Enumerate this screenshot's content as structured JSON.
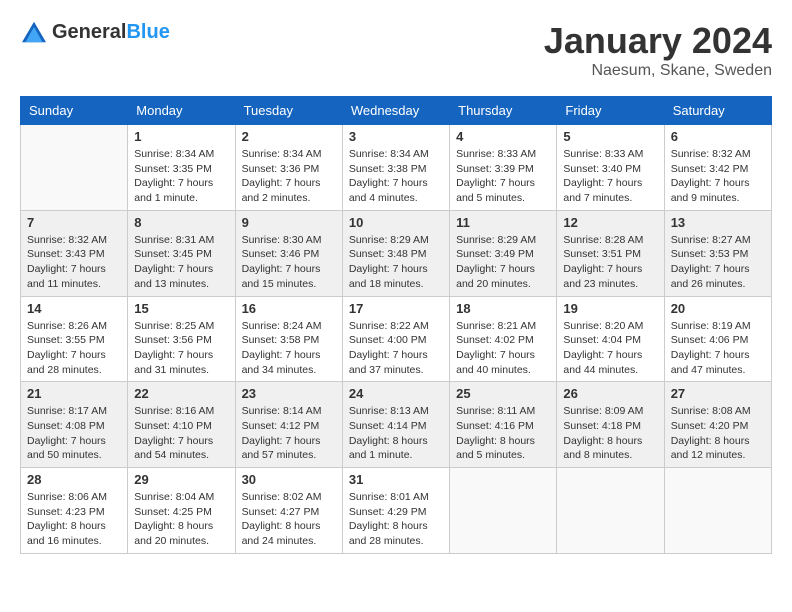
{
  "header": {
    "logo": {
      "text_general": "General",
      "text_blue": "Blue"
    },
    "title": "January 2024",
    "location": "Naesum, Skane, Sweden"
  },
  "weekdays": [
    "Sunday",
    "Monday",
    "Tuesday",
    "Wednesday",
    "Thursday",
    "Friday",
    "Saturday"
  ],
  "weeks": [
    [
      {
        "day": null,
        "sunrise": null,
        "sunset": null,
        "daylight": null
      },
      {
        "day": "1",
        "sunrise": "Sunrise: 8:34 AM",
        "sunset": "Sunset: 3:35 PM",
        "daylight": "Daylight: 7 hours and 1 minute."
      },
      {
        "day": "2",
        "sunrise": "Sunrise: 8:34 AM",
        "sunset": "Sunset: 3:36 PM",
        "daylight": "Daylight: 7 hours and 2 minutes."
      },
      {
        "day": "3",
        "sunrise": "Sunrise: 8:34 AM",
        "sunset": "Sunset: 3:38 PM",
        "daylight": "Daylight: 7 hours and 4 minutes."
      },
      {
        "day": "4",
        "sunrise": "Sunrise: 8:33 AM",
        "sunset": "Sunset: 3:39 PM",
        "daylight": "Daylight: 7 hours and 5 minutes."
      },
      {
        "day": "5",
        "sunrise": "Sunrise: 8:33 AM",
        "sunset": "Sunset: 3:40 PM",
        "daylight": "Daylight: 7 hours and 7 minutes."
      },
      {
        "day": "6",
        "sunrise": "Sunrise: 8:32 AM",
        "sunset": "Sunset: 3:42 PM",
        "daylight": "Daylight: 7 hours and 9 minutes."
      }
    ],
    [
      {
        "day": "7",
        "sunrise": "Sunrise: 8:32 AM",
        "sunset": "Sunset: 3:43 PM",
        "daylight": "Daylight: 7 hours and 11 minutes."
      },
      {
        "day": "8",
        "sunrise": "Sunrise: 8:31 AM",
        "sunset": "Sunset: 3:45 PM",
        "daylight": "Daylight: 7 hours and 13 minutes."
      },
      {
        "day": "9",
        "sunrise": "Sunrise: 8:30 AM",
        "sunset": "Sunset: 3:46 PM",
        "daylight": "Daylight: 7 hours and 15 minutes."
      },
      {
        "day": "10",
        "sunrise": "Sunrise: 8:29 AM",
        "sunset": "Sunset: 3:48 PM",
        "daylight": "Daylight: 7 hours and 18 minutes."
      },
      {
        "day": "11",
        "sunrise": "Sunrise: 8:29 AM",
        "sunset": "Sunset: 3:49 PM",
        "daylight": "Daylight: 7 hours and 20 minutes."
      },
      {
        "day": "12",
        "sunrise": "Sunrise: 8:28 AM",
        "sunset": "Sunset: 3:51 PM",
        "daylight": "Daylight: 7 hours and 23 minutes."
      },
      {
        "day": "13",
        "sunrise": "Sunrise: 8:27 AM",
        "sunset": "Sunset: 3:53 PM",
        "daylight": "Daylight: 7 hours and 26 minutes."
      }
    ],
    [
      {
        "day": "14",
        "sunrise": "Sunrise: 8:26 AM",
        "sunset": "Sunset: 3:55 PM",
        "daylight": "Daylight: 7 hours and 28 minutes."
      },
      {
        "day": "15",
        "sunrise": "Sunrise: 8:25 AM",
        "sunset": "Sunset: 3:56 PM",
        "daylight": "Daylight: 7 hours and 31 minutes."
      },
      {
        "day": "16",
        "sunrise": "Sunrise: 8:24 AM",
        "sunset": "Sunset: 3:58 PM",
        "daylight": "Daylight: 7 hours and 34 minutes."
      },
      {
        "day": "17",
        "sunrise": "Sunrise: 8:22 AM",
        "sunset": "Sunset: 4:00 PM",
        "daylight": "Daylight: 7 hours and 37 minutes."
      },
      {
        "day": "18",
        "sunrise": "Sunrise: 8:21 AM",
        "sunset": "Sunset: 4:02 PM",
        "daylight": "Daylight: 7 hours and 40 minutes."
      },
      {
        "day": "19",
        "sunrise": "Sunrise: 8:20 AM",
        "sunset": "Sunset: 4:04 PM",
        "daylight": "Daylight: 7 hours and 44 minutes."
      },
      {
        "day": "20",
        "sunrise": "Sunrise: 8:19 AM",
        "sunset": "Sunset: 4:06 PM",
        "daylight": "Daylight: 7 hours and 47 minutes."
      }
    ],
    [
      {
        "day": "21",
        "sunrise": "Sunrise: 8:17 AM",
        "sunset": "Sunset: 4:08 PM",
        "daylight": "Daylight: 7 hours and 50 minutes."
      },
      {
        "day": "22",
        "sunrise": "Sunrise: 8:16 AM",
        "sunset": "Sunset: 4:10 PM",
        "daylight": "Daylight: 7 hours and 54 minutes."
      },
      {
        "day": "23",
        "sunrise": "Sunrise: 8:14 AM",
        "sunset": "Sunset: 4:12 PM",
        "daylight": "Daylight: 7 hours and 57 minutes."
      },
      {
        "day": "24",
        "sunrise": "Sunrise: 8:13 AM",
        "sunset": "Sunset: 4:14 PM",
        "daylight": "Daylight: 8 hours and 1 minute."
      },
      {
        "day": "25",
        "sunrise": "Sunrise: 8:11 AM",
        "sunset": "Sunset: 4:16 PM",
        "daylight": "Daylight: 8 hours and 5 minutes."
      },
      {
        "day": "26",
        "sunrise": "Sunrise: 8:09 AM",
        "sunset": "Sunset: 4:18 PM",
        "daylight": "Daylight: 8 hours and 8 minutes."
      },
      {
        "day": "27",
        "sunrise": "Sunrise: 8:08 AM",
        "sunset": "Sunset: 4:20 PM",
        "daylight": "Daylight: 8 hours and 12 minutes."
      }
    ],
    [
      {
        "day": "28",
        "sunrise": "Sunrise: 8:06 AM",
        "sunset": "Sunset: 4:23 PM",
        "daylight": "Daylight: 8 hours and 16 minutes."
      },
      {
        "day": "29",
        "sunrise": "Sunrise: 8:04 AM",
        "sunset": "Sunset: 4:25 PM",
        "daylight": "Daylight: 8 hours and 20 minutes."
      },
      {
        "day": "30",
        "sunrise": "Sunrise: 8:02 AM",
        "sunset": "Sunset: 4:27 PM",
        "daylight": "Daylight: 8 hours and 24 minutes."
      },
      {
        "day": "31",
        "sunrise": "Sunrise: 8:01 AM",
        "sunset": "Sunset: 4:29 PM",
        "daylight": "Daylight: 8 hours and 28 minutes."
      },
      {
        "day": null,
        "sunrise": null,
        "sunset": null,
        "daylight": null
      },
      {
        "day": null,
        "sunrise": null,
        "sunset": null,
        "daylight": null
      },
      {
        "day": null,
        "sunrise": null,
        "sunset": null,
        "daylight": null
      }
    ]
  ]
}
